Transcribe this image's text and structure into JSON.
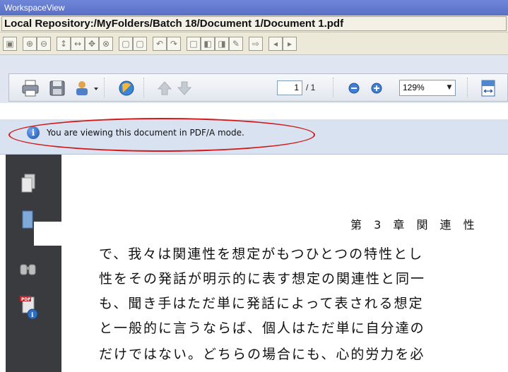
{
  "window": {
    "title": "WorkspaceView"
  },
  "path": {
    "value": "Local Repository:/MyFolders/Batch 18/Document 1/Document 1.pdf"
  },
  "toolbar": {
    "page_current": "1",
    "page_total": "/ 1",
    "zoom": "129%"
  },
  "info": {
    "message": "You are viewing this document in PDF/A mode."
  },
  "document": {
    "heading": "第 3 章 関 連 性",
    "lines": [
      "で、我々は関連性を想定がもつひとつの特性とし",
      "性をその発話が明示的に表す想定の関連性と同一",
      "も、聞き手はただ単に発話によって表される想定",
      "と一般的に言うならば、個人はただ単に自分達の",
      "だけではない。どちらの場合にも、心的労力を必"
    ]
  },
  "colors": {
    "annotation_ellipse": "#d21a1a",
    "info_bar": "#d8e2f0",
    "sidebar": "#393b3f"
  }
}
